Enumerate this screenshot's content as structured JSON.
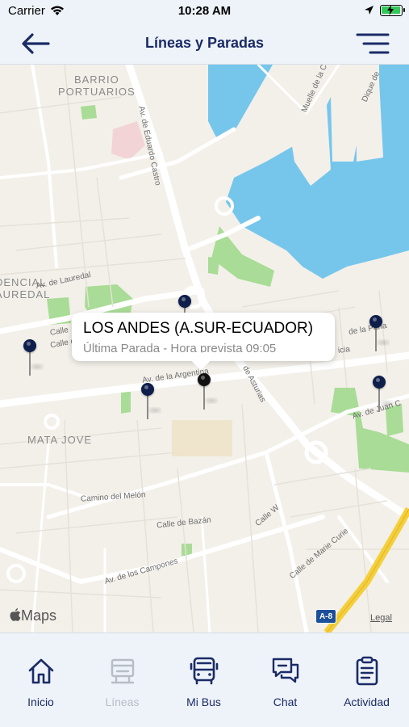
{
  "status_bar": {
    "carrier": "Carrier",
    "time": "10:28 AM"
  },
  "nav": {
    "title": "Líneas y Paradas",
    "back_icon": "back-arrow-icon",
    "menu_icon": "menu-icon"
  },
  "map": {
    "districts": [
      "BARRIO\nPORTUARIOS",
      "DENCIAL\nAUREDAL",
      "MATA JOVE"
    ],
    "streets": [
      "Av. de Eduardo Castro",
      "Av. de Lauredal",
      "Calle",
      "Calle de He",
      "Av. de la Argentina",
      "de Asturias",
      "icia",
      "de la Peña",
      "Av. de Juan C",
      "Camino del Melón",
      "Calle de Bazán",
      "Calle W",
      "Calle de Marie Curie",
      "Av. de los Campones",
      "Muelle de la C",
      "Dique de"
    ],
    "callout": {
      "title": "LOS ANDES (A.SUR-ECUADOR)",
      "subtitle": "Última Parada - Hora prevista 09:05"
    },
    "road_shield": "A-8",
    "attribution": "Maps",
    "legal": "Legal"
  },
  "tabs": [
    {
      "label": "Inicio",
      "icon": "home-icon",
      "enabled": true
    },
    {
      "label": "Líneas",
      "icon": "bus-stop-icon",
      "enabled": false
    },
    {
      "label": "Mi Bus",
      "icon": "bus-icon",
      "enabled": true
    },
    {
      "label": "Chat",
      "icon": "chat-icon",
      "enabled": true
    },
    {
      "label": "Actividad",
      "icon": "clipboard-icon",
      "enabled": true
    }
  ],
  "colors": {
    "accent": "#1a2b66",
    "water": "#76c6ec",
    "park": "#a9dc96",
    "bar_bg": "#eef3f9",
    "disabled": "#b7bdc6"
  }
}
